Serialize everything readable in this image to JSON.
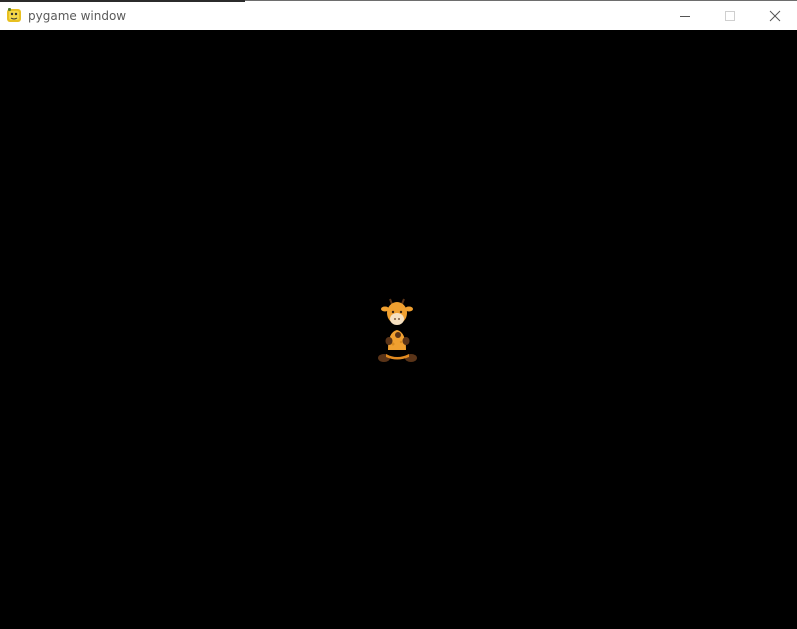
{
  "window": {
    "title": "pygame window",
    "background": "#000000",
    "titlebar_background": "#ffffff",
    "icons": {
      "app": "pygame-snake-icon",
      "minimize": "minimize-icon",
      "maximize": "maximize-icon",
      "close": "close-icon"
    }
  },
  "game": {
    "sprite": "giraffe-sprite",
    "colors": {
      "body": "#f0a030",
      "dark": "#5a3418",
      "face": "#f6e0c0"
    }
  }
}
